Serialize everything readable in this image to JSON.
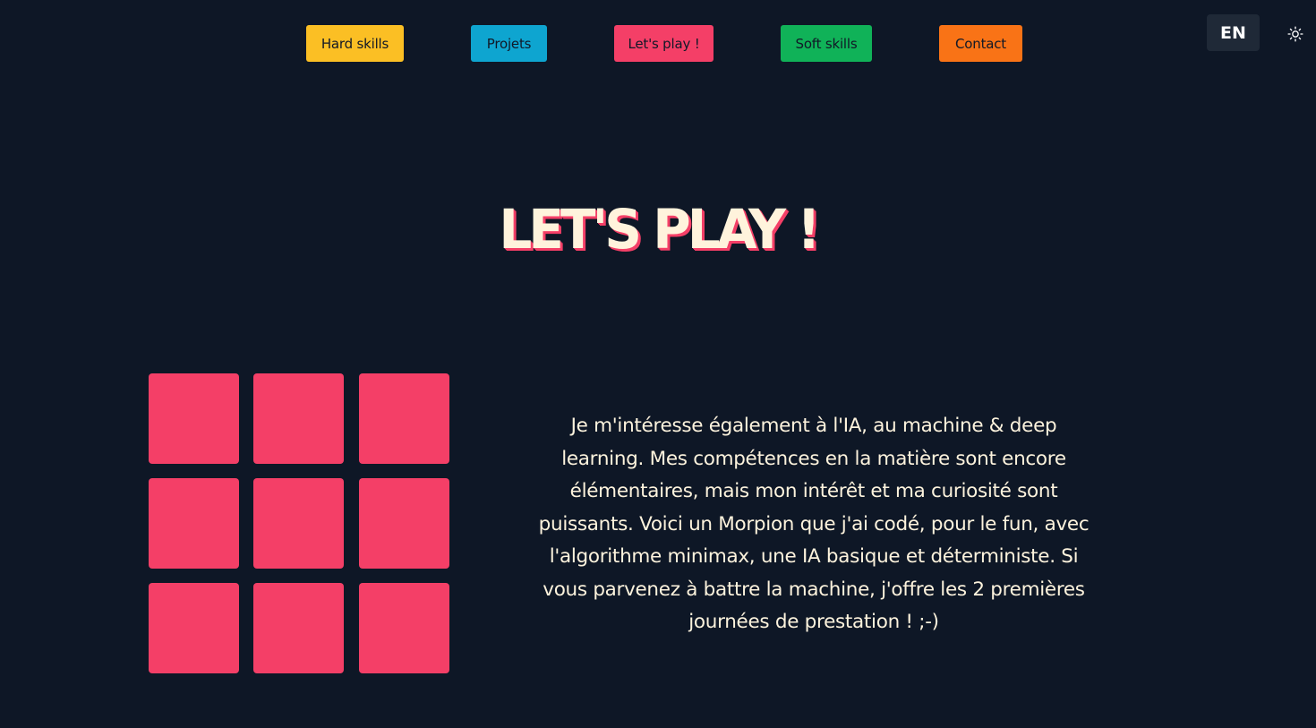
{
  "nav": {
    "items": [
      {
        "label": "Hard skills",
        "color": "#fbbf24"
      },
      {
        "label": "Projets",
        "color": "#0ea5d0"
      },
      {
        "label": "Let's play !",
        "color": "#f43f67"
      },
      {
        "label": "Soft skills",
        "color": "#10b258"
      },
      {
        "label": "Contact",
        "color": "#f97316"
      }
    ]
  },
  "header": {
    "language_label": "EN",
    "theme_icon": "sun-icon"
  },
  "main": {
    "title": "LET'S PLAY !",
    "description": "Je m'intéresse également à l'IA, au machine & deep learning. Mes compétences en la matière sont encore élémentaires, mais mon intérêt et ma curiosité sont puissants. Voici un Morpion que j'ai codé, pour le fun, avec l'algorithme minimax, une IA basique et déterministe. Si vous parvenez à battre la machine, j'offre les 2 premières journées de prestation ! ;-)"
  },
  "game": {
    "name": "Morpion",
    "cells": [
      "",
      "",
      "",
      "",
      "",
      "",
      "",
      "",
      ""
    ],
    "cell_color": "#f43f67"
  },
  "colors": {
    "background": "#0e1726",
    "text": "#fdf3dd",
    "accent": "#f43f67"
  }
}
